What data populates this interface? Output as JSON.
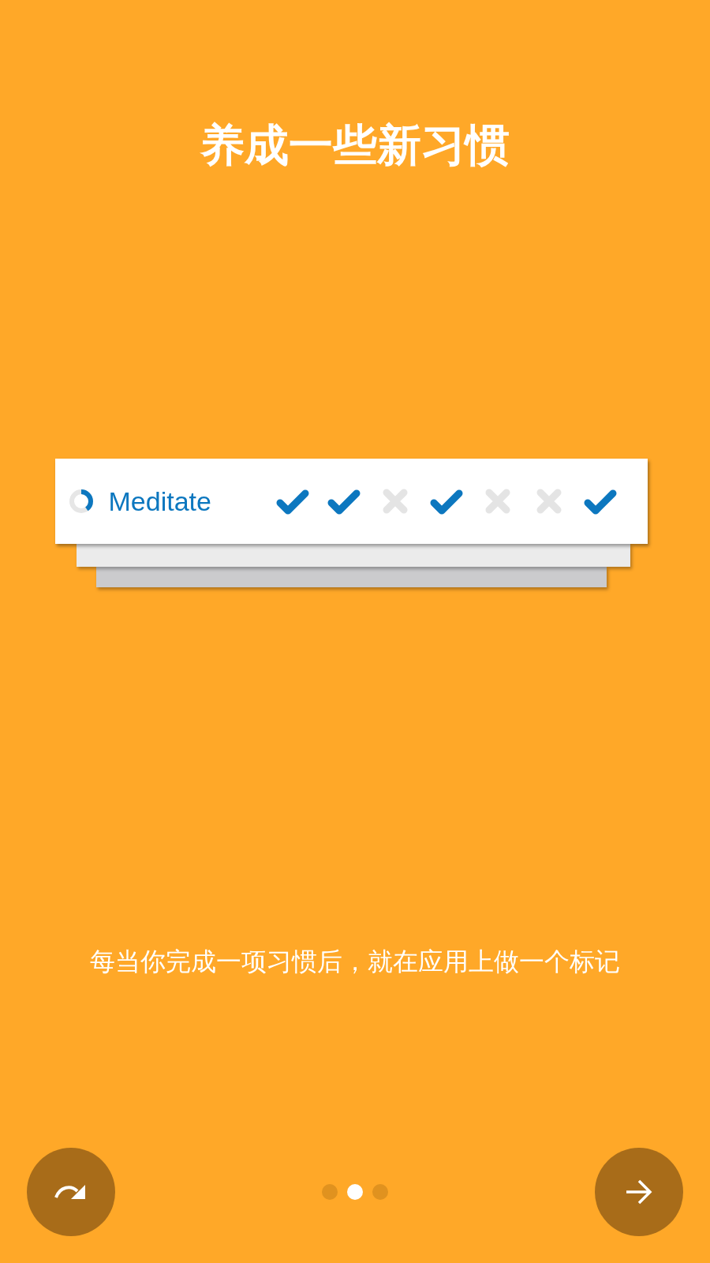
{
  "title": "养成一些新习惯",
  "habit": {
    "name": "Meditate",
    "marks": [
      {
        "checked": true
      },
      {
        "checked": true
      },
      {
        "checked": false
      },
      {
        "checked": true
      },
      {
        "checked": false
      },
      {
        "checked": false
      },
      {
        "checked": true
      }
    ]
  },
  "description": "每当你完成一项习惯后，就在应用上做一个标记",
  "pages": [
    {
      "selected": false
    },
    {
      "selected": true
    },
    {
      "selected": false
    }
  ]
}
